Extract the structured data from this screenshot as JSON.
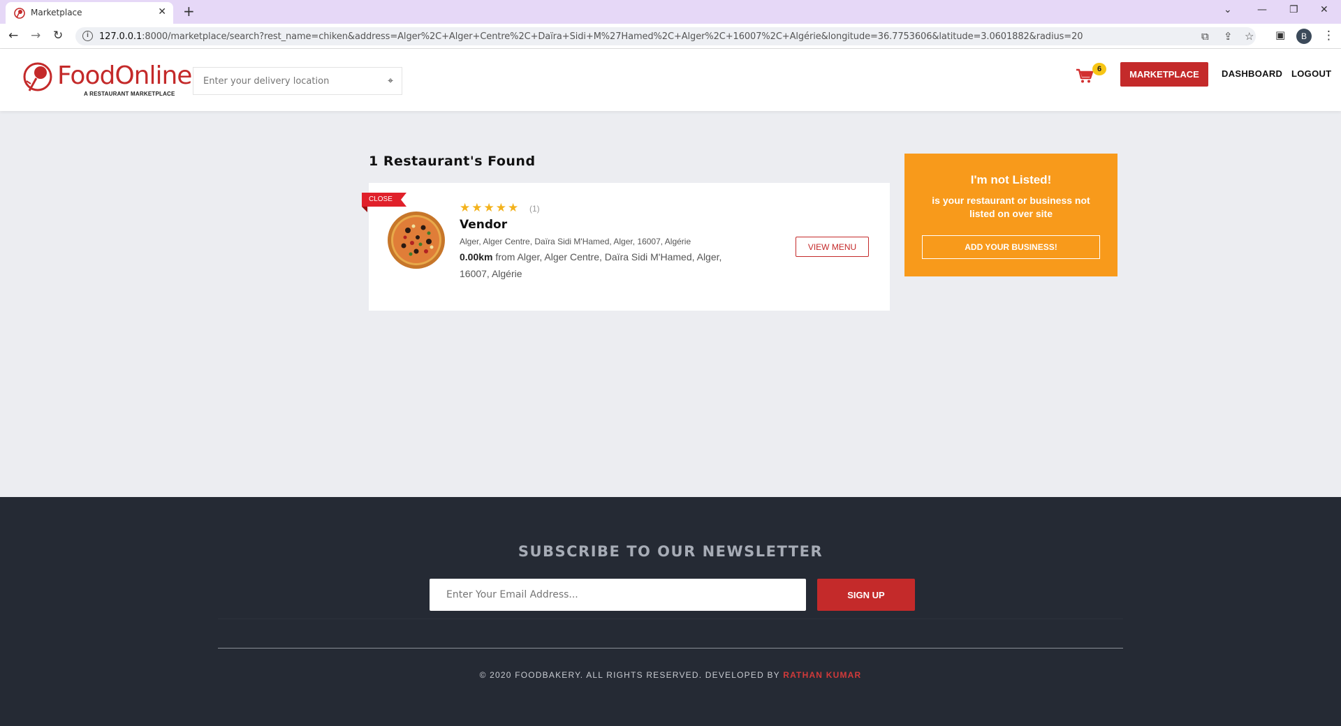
{
  "browser": {
    "tab_title": "Marketplace",
    "tab_close": "✕",
    "new_tab": "+",
    "url_host": "127.0.0.1",
    "url_rest": ":8000/marketplace/search?rest_name=chiken&address=Alger%2C+Alger+Centre%2C+Daïra+Sidi+M%27Hamed%2C+Alger%2C+16007%2C+Algérie&longitude=36.7753606&latitude=3.0601882&radius=20",
    "profile_initial": "B"
  },
  "header": {
    "logo_text": "FoodOnline",
    "logo_tagline": "A RESTAURANT MARKETPLACE",
    "location_placeholder": "Enter your delivery location",
    "cart_count": "6",
    "marketplace_label": "MARKETPLACE",
    "dashboard_label": "DASHBOARD",
    "logout_label": "LOGOUT"
  },
  "results": {
    "title": "1 Restaurant's Found",
    "items": [
      {
        "status": "CLOSE",
        "stars": "★★★★★",
        "rating_count": "(1)",
        "name": "Vendor",
        "address": "Alger, Alger Centre, Daïra Sidi M'Hamed, Alger, 16007, Algérie",
        "distance": "0.00km",
        "distance_from": " from Alger, Alger Centre, Daïra Sidi M'Hamed, Alger, 16007, Algérie",
        "view_menu_label": "VIEW MENU"
      }
    ]
  },
  "not_listed": {
    "title": "I'm not Listed!",
    "subtitle": "is your restaurant or business not listed on over site",
    "button_label": "ADD YOUR BUSINESS!"
  },
  "footer": {
    "newsletter_heading": "SUBSCRIBE TO OUR NEWSLETTER",
    "email_placeholder": "Enter Your Email Address...",
    "signup_label": "SIGN UP",
    "copyright": "© 2020 FOODBAKERY. ALL RIGHTS RESERVED. DEVELOPED BY ",
    "developer": "RATHAN KUMAR"
  },
  "colors": {
    "brand_red": "#c42a2a",
    "orange": "#f89a1b",
    "footer_bg": "#252a34",
    "star": "#f3b21c"
  }
}
